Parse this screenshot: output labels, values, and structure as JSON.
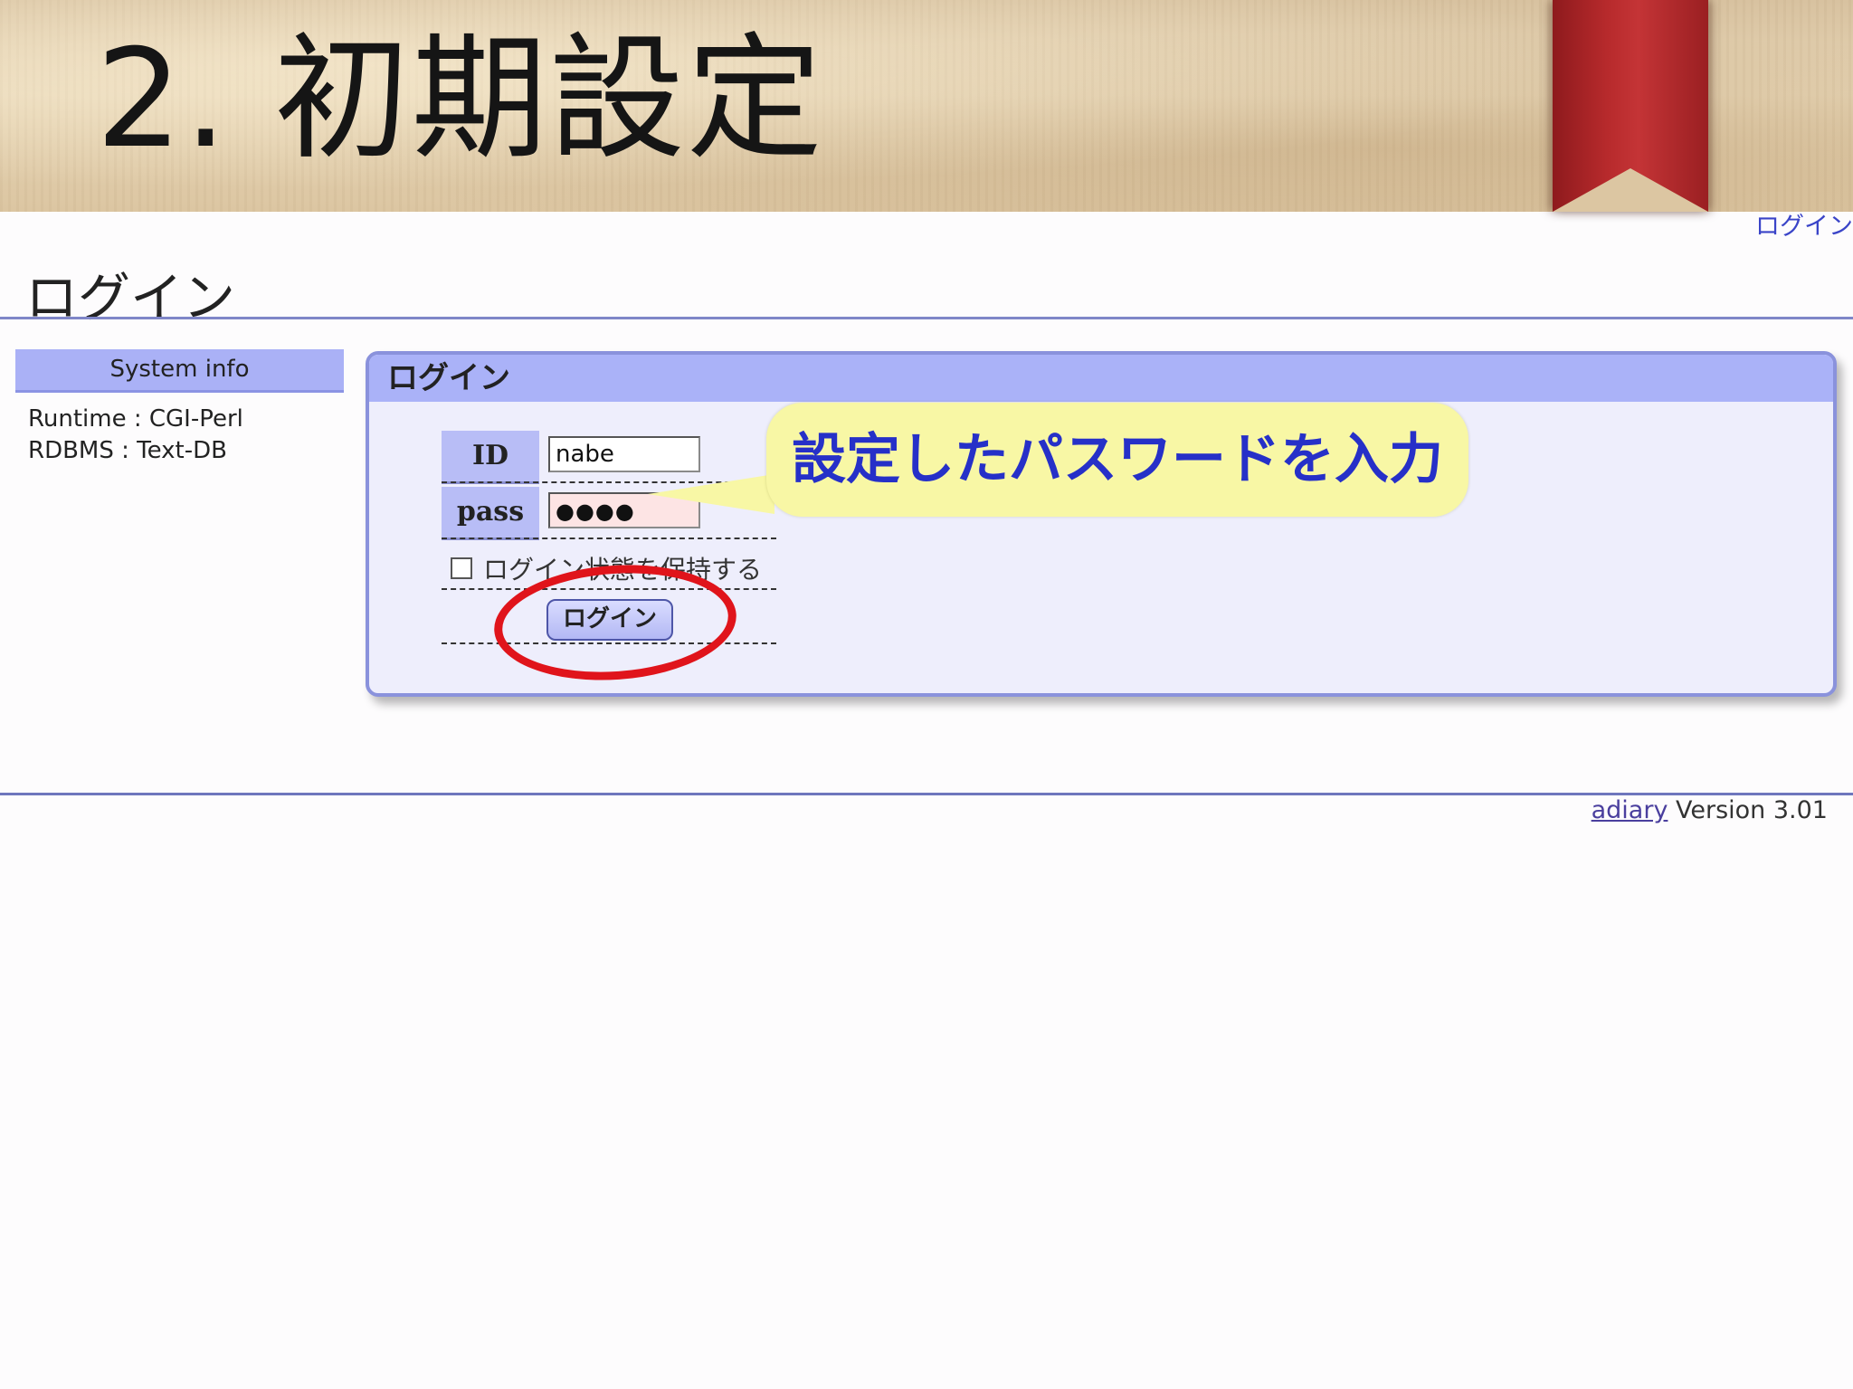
{
  "slide": {
    "title": "2. 初期設定"
  },
  "header": {
    "login_link": "ログイン"
  },
  "page": {
    "title": "ログイン"
  },
  "sidebar": {
    "heading": "System info",
    "lines": [
      "Runtime : CGI-Perl",
      "RDBMS : Text-DB"
    ]
  },
  "login_form": {
    "heading": "ログイン",
    "id_label": "ID",
    "id_value": "nabe",
    "pass_label": "pass",
    "pass_value": "●●●●",
    "remember_label": "ログイン状態を保持する",
    "remember_checked": false,
    "submit_label": "ログイン"
  },
  "annotation": {
    "callout_text": "設定したパスワードを入力",
    "highlight_color": "#e0141b",
    "callout_color": "#f8f7a5"
  },
  "footer": {
    "link": "adiary",
    "version": " Version 3.01"
  }
}
